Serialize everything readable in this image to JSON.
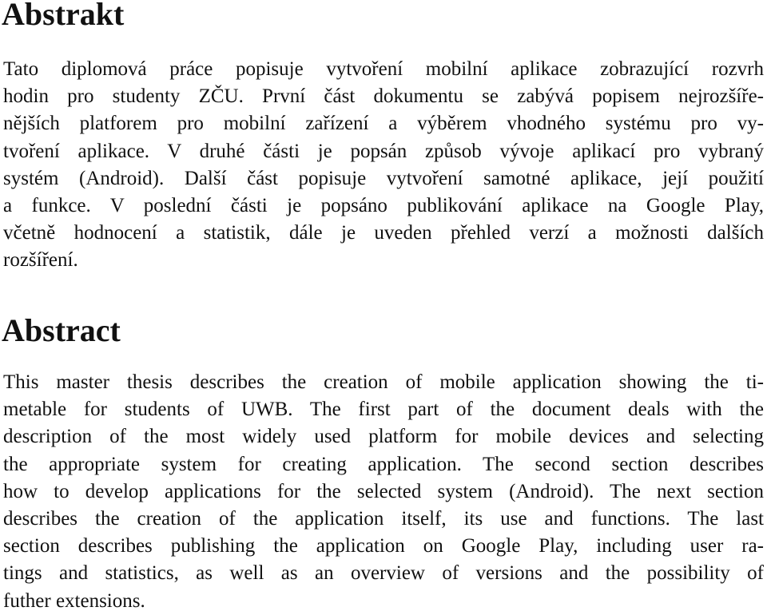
{
  "sections": [
    {
      "heading": "Abstrakt",
      "lines": [
        "Tato diplomová práce popisuje vytvoření mobilní aplikace zobrazující rozvrh",
        "hodin pro studenty ZČU. První část dokumentu se zabývá popisem nejrozšíře-",
        "nějších platforem pro mobilní zařízení a výběrem vhodného systému pro vy-",
        "tvoření aplikace. V druhé části je popsán způsob vývoje aplikací pro vybraný",
        "systém (Android). Další část popisuje vytvoření samotné aplikace, její použití",
        "a funkce. V poslední části je popsáno publikování aplikace na Google Play,",
        "včetně hodnocení a statistik, dále je uveden přehled verzí a možnosti dalších",
        "rozšíření."
      ]
    },
    {
      "heading": "Abstract",
      "lines": [
        "This master thesis describes the creation of mobile application showing the ti-",
        "metable for students of UWB. The first part of the document deals with the",
        "description of the most widely used platform for mobile devices and selecting",
        "the appropriate system for creating application. The second section describes",
        "how to develop applications for the selected system (Android). The next section",
        "describes the creation of the application itself, its use and functions. The last",
        "section describes publishing the application on Google Play, including user ra-",
        "tings and statistics, as well as an overview of versions and the possibility of",
        "futher extensions."
      ]
    }
  ]
}
